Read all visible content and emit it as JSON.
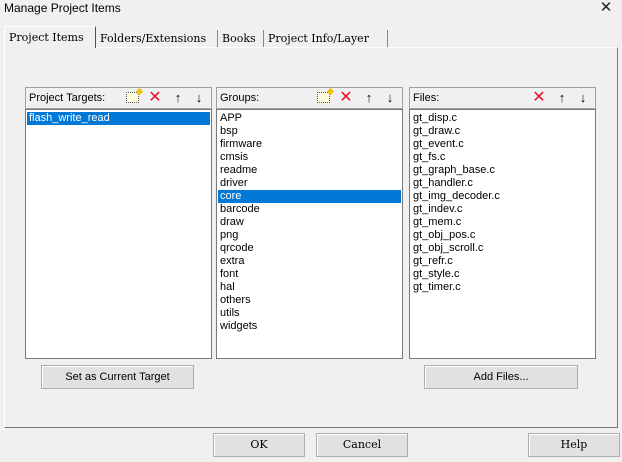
{
  "window": {
    "title": "Manage Project Items",
    "close_glyph": "✕"
  },
  "tabs": [
    {
      "label": "Project Items",
      "active": true
    },
    {
      "label": "Folders/Extensions",
      "active": false
    },
    {
      "label": "Books",
      "active": false
    },
    {
      "label": "Project Info/Layer",
      "active": false
    }
  ],
  "targets": {
    "label": "Project Targets:",
    "items": [
      "flash_write_read"
    ],
    "selected": "flash_write_read",
    "set_current_button": "Set as Current Target"
  },
  "groups": {
    "label": "Groups:",
    "items": [
      "APP",
      "bsp",
      "firmware",
      "cmsis",
      "readme",
      "driver",
      "core",
      "barcode",
      "draw",
      "png",
      "qrcode",
      "extra",
      "font",
      "hal",
      "others",
      "utils",
      "widgets"
    ],
    "selected": "core"
  },
  "files": {
    "label": "Files:",
    "items": [
      "gt_disp.c",
      "gt_draw.c",
      "gt_event.c",
      "gt_fs.c",
      "gt_graph_base.c",
      "gt_handler.c",
      "gt_img_decoder.c",
      "gt_indev.c",
      "gt_mem.c",
      "gt_obj_pos.c",
      "gt_obj_scroll.c",
      "gt_refr.c",
      "gt_style.c",
      "gt_timer.c"
    ],
    "add_files_button": "Add Files..."
  },
  "toolbar_glyphs": {
    "delete": "✕",
    "move_up": "↑",
    "move_down": "↓"
  },
  "footer": {
    "ok": "OK",
    "cancel": "Cancel",
    "help": "Help"
  }
}
